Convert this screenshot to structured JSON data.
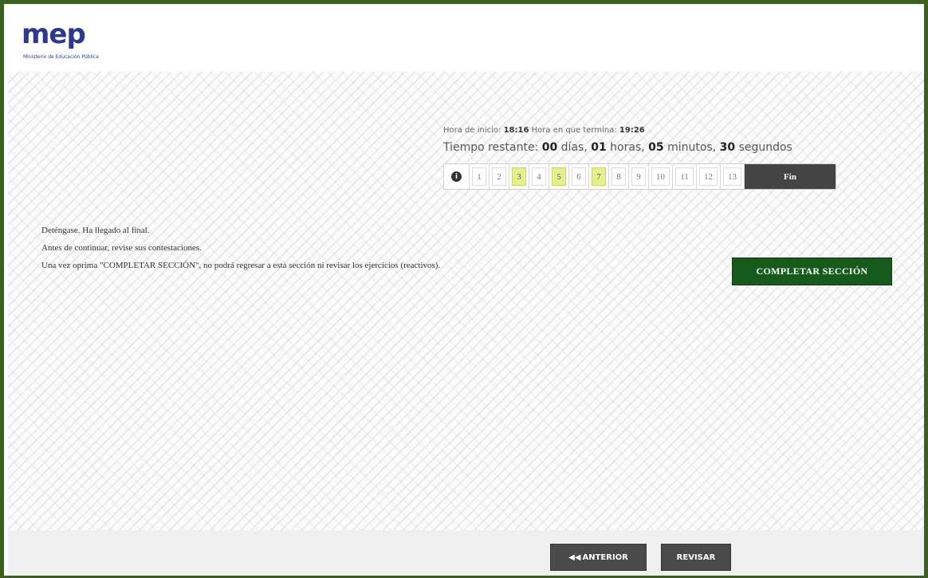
{
  "logo": {
    "word": "mep",
    "subtitle": "Ministerio de Educación Pública"
  },
  "timer": {
    "start_label": "Hora de inicio:",
    "start_time": "18:16",
    "end_label": "Hora en que termina:",
    "end_time": "19:26",
    "remaining_label": "Tiempo restante:",
    "days": "00",
    "days_label": "días,",
    "hours": "01",
    "hours_label": "horas,",
    "minutes": "05",
    "minutes_label": "minutos,",
    "seconds": "30",
    "seconds_label": "segundos"
  },
  "question_nav": {
    "info_icon": "info-icon",
    "items": [
      {
        "label": "1"
      },
      {
        "label": "2"
      },
      {
        "label": "3"
      },
      {
        "label": "4"
      },
      {
        "label": "5"
      },
      {
        "label": "6"
      },
      {
        "label": "7"
      },
      {
        "label": "8"
      },
      {
        "label": "9"
      },
      {
        "label": "10"
      },
      {
        "label": "11"
      },
      {
        "label": "12"
      },
      {
        "label": "13"
      }
    ],
    "highlighted": [
      "3",
      "5",
      "7"
    ],
    "fin_label": "Fin"
  },
  "messages": {
    "line1": "Deténgase. Ha llegado al final.",
    "line2": "Antes de continuar, revise sus contestaciones.",
    "line3": "Una vez oprima \"COMPLETAR SECCIÓN\", no podrá regresar a esta sección ni revisar los ejercicios (reactivos)."
  },
  "complete_button": "COMPLETAR SECCIÓN",
  "footer": {
    "prev_icon": "double-left-arrow-icon",
    "prev_label": "ANTERIOR",
    "review_label": "REVISAR"
  },
  "colors": {
    "frame": "#3c5f22",
    "complete_button": "#175b1c",
    "highlight": "#e6f08c",
    "dark_button": "#4a4a4a",
    "logo": "#2b3a8c"
  }
}
